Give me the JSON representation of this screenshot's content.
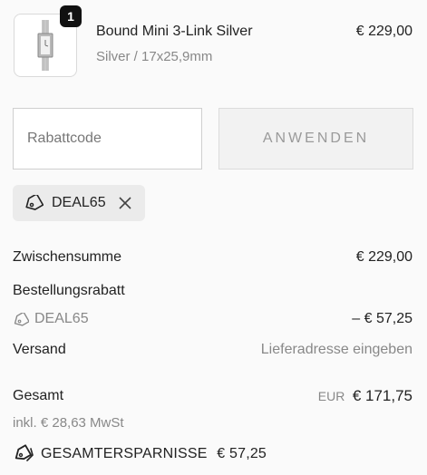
{
  "product": {
    "quantity": "1",
    "name": "Bound Mini 3-Link Silver",
    "variant": "Silver / 17x25,9mm",
    "price": "€ 229,00",
    "image_icon": "watch-image"
  },
  "discount": {
    "placeholder": "Rabattcode",
    "apply_label": "ANWENDEN",
    "applied_code": "DEAL65"
  },
  "summary": {
    "subtotal_label": "Zwischensumme",
    "subtotal_value": "€ 229,00",
    "order_discount_label": "Bestellungsrabatt",
    "order_discount_code": "DEAL65",
    "order_discount_value": "– € 57,25",
    "shipping_label": "Versand",
    "shipping_value": "Lieferadresse eingeben",
    "total_label": "Gesamt",
    "total_currency": "EUR",
    "total_value": "€ 171,75",
    "tax_note": "inkl. € 28,63 MwSt",
    "savings_label": "GESAMTERSPARNISSE",
    "savings_value": "€ 57,25"
  },
  "colors": {
    "badge": "#111111",
    "chip_bg": "#ebebeb",
    "muted_text": "#888888",
    "button_bg": "#f2f2f2"
  }
}
